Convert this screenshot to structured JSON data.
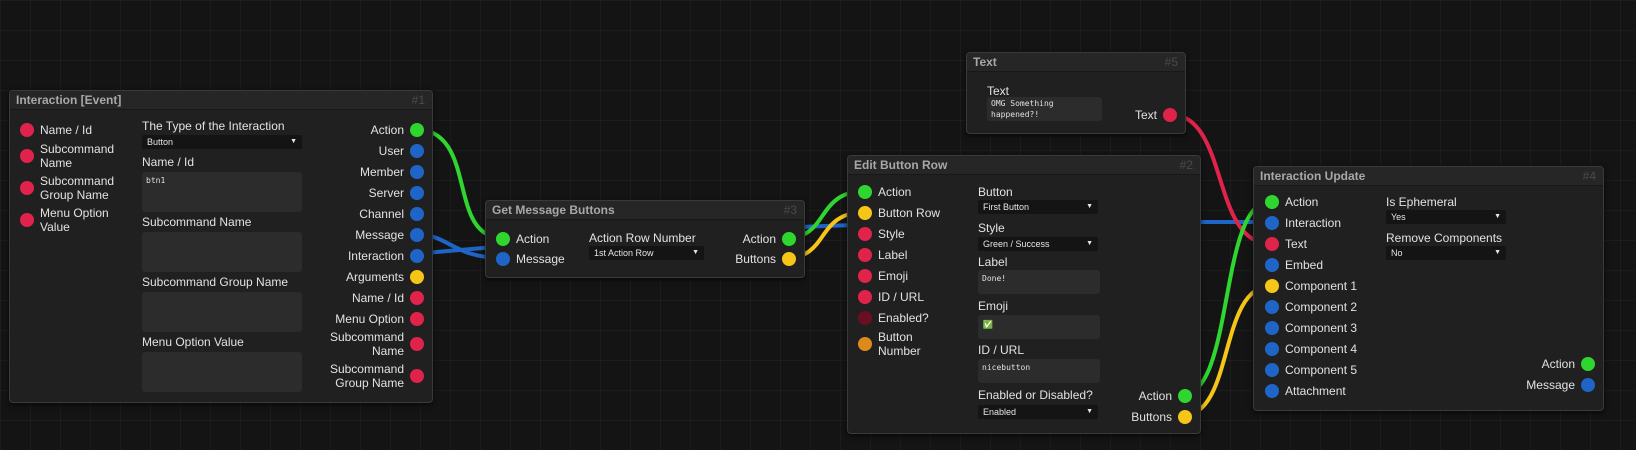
{
  "colors": {
    "action": "#2fd62f",
    "object": "#1f65c8",
    "text": "#e0234a",
    "component": "#f5c518",
    "boolean": "#6b0e22",
    "number": "#de8a1a"
  },
  "nodes": {
    "interaction_event": {
      "title": "Interaction [Event]",
      "num": "#1",
      "inputs": [
        "Name / Id",
        "Subcommand Name",
        "Subcommand Group Name",
        "Menu Option Value"
      ],
      "fields": {
        "type_label": "The Type of the Interaction",
        "type_value": "Button",
        "name_label": "Name / Id",
        "name_value": "btn1",
        "subcommand_label": "Subcommand Name",
        "subcommand_value": "",
        "group_label": "Subcommand Group Name",
        "group_value": "",
        "option_label": "Menu Option Value",
        "option_value": ""
      },
      "outputs": [
        "Action",
        "User",
        "Member",
        "Server",
        "Channel",
        "Message",
        "Interaction",
        "Arguments",
        "Name / Id",
        "Menu Option",
        "Subcommand Name",
        "Subcommand Group Name"
      ]
    },
    "get_message_buttons": {
      "title": "Get Message Buttons",
      "num": "#3",
      "inputs": [
        "Action",
        "Message"
      ],
      "fields": {
        "row_label": "Action Row Number",
        "row_value": "1st Action Row"
      },
      "outputs": [
        "Action",
        "Buttons"
      ]
    },
    "text": {
      "title": "Text",
      "num": "#5",
      "fields": {
        "text_label": "Text",
        "text_value": "OMG Something\nhappened?!"
      },
      "outputs": [
        "Text"
      ]
    },
    "edit_button_row": {
      "title": "Edit Button Row",
      "num": "#2",
      "inputs": [
        "Action",
        "Button Row",
        "Style",
        "Label",
        "Emoji",
        "ID / URL",
        "Enabled?",
        "Button Number"
      ],
      "fields": {
        "button_label": "Button",
        "button_value": "First Button",
        "style_label": "Style",
        "style_value": "Green / Success",
        "label_label": "Label",
        "label_value": "Done!",
        "emoji_label": "Emoji",
        "emoji_value": "✅",
        "id_label": "ID / URL",
        "id_value": "nicebutton",
        "enabled_label": "Enabled or Disabled?",
        "enabled_value": "Enabled"
      },
      "outputs": [
        "Action",
        "Buttons"
      ]
    },
    "interaction_update": {
      "title": "Interaction Update",
      "num": "#4",
      "inputs": [
        "Action",
        "Interaction",
        "Text",
        "Embed",
        "Component 1",
        "Component 2",
        "Component 3",
        "Component 4",
        "Component 5",
        "Attachment"
      ],
      "fields": {
        "ephemeral_label": "Is Ephemeral",
        "ephemeral_value": "Yes",
        "remove_label": "Remove Components",
        "remove_value": "No"
      },
      "outputs": [
        "Action",
        "Message"
      ]
    }
  },
  "connections": [
    {
      "from": "Interaction [Event].Action",
      "to": "Get Message Buttons.Action",
      "type": "action"
    },
    {
      "from": "Interaction [Event].Message",
      "to": "Get Message Buttons.Message",
      "type": "object"
    },
    {
      "from": "Interaction [Event].Interaction",
      "to": "Interaction Update.Interaction",
      "type": "object"
    },
    {
      "from": "Get Message Buttons.Action",
      "to": "Edit Button Row.Action",
      "type": "action"
    },
    {
      "from": "Get Message Buttons.Buttons",
      "to": "Edit Button Row.Button Row",
      "type": "component"
    },
    {
      "from": "Text.Text",
      "to": "Interaction Update.Text",
      "type": "text"
    },
    {
      "from": "Edit Button Row.Action",
      "to": "Interaction Update.Action",
      "type": "action"
    },
    {
      "from": "Edit Button Row.Buttons",
      "to": "Interaction Update.Component 1",
      "type": "component"
    }
  ]
}
